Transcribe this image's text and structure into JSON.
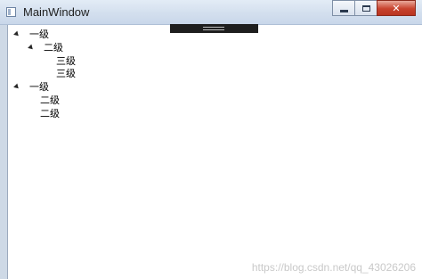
{
  "window": {
    "title": "MainWindow"
  },
  "caption": {
    "minimize": "minimize",
    "maximize": "maximize",
    "close": "✕"
  },
  "tree": [
    {
      "label": "一级",
      "expanded": true
    },
    {
      "label": "二级",
      "expanded": true
    },
    {
      "label": "三级"
    },
    {
      "label": "三级"
    },
    {
      "label": "一级",
      "expanded": true
    },
    {
      "label": "二级"
    },
    {
      "label": "二级"
    }
  ],
  "watermark": "https://blog.csdn.net/qq_43026206"
}
